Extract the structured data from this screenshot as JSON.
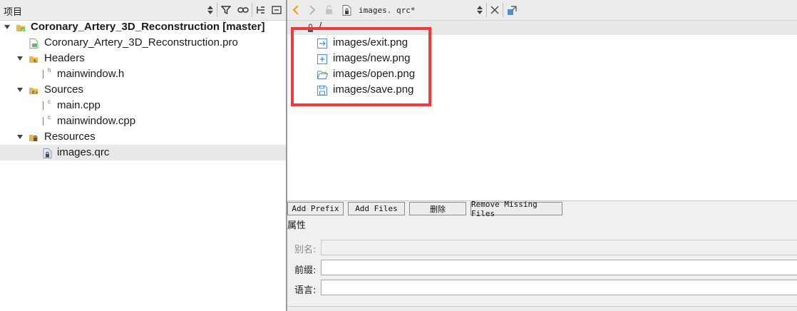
{
  "left_panel": {
    "title": "项目",
    "toolbar_icons": [
      "updown-icon",
      "filter-icon",
      "link-icon",
      "split-icon",
      "close-panel-icon"
    ],
    "project": {
      "name": "Coronary_Artery_3D_Reconstruction [master]",
      "pro_file": "Coronary_Artery_3D_Reconstruction.pro",
      "headers": {
        "label": "Headers",
        "files": [
          "mainwindow.h"
        ]
      },
      "sources": {
        "label": "Sources",
        "files": [
          "main.cpp",
          "mainwindow.cpp"
        ]
      },
      "resources": {
        "label": "Resources",
        "files": [
          "images.qrc"
        ]
      }
    },
    "selected_file": "images.qrc"
  },
  "editor": {
    "file_name": "images. qrc*",
    "prefix": "/",
    "resources": [
      {
        "name": "images/exit.png",
        "icon": "exit-icon"
      },
      {
        "name": "images/new.png",
        "icon": "new-file-icon"
      },
      {
        "name": "images/open.png",
        "icon": "open-folder-icon"
      },
      {
        "name": "images/save.png",
        "icon": "save-icon"
      }
    ],
    "highlight_color": "#ef3b3b",
    "buttons": {
      "add_prefix": "Add Prefix",
      "add_files": "Add Files",
      "delete": "删除",
      "remove_missing": "Remove Missing Files"
    },
    "properties": {
      "title": "属性",
      "alias_label": "别名:",
      "prefix_label": "前缀:",
      "language_label": "语言:"
    }
  },
  "colors": {
    "accent": "#e8a500",
    "folder": "#e8b84a",
    "file_icon": "#4a90d9"
  }
}
